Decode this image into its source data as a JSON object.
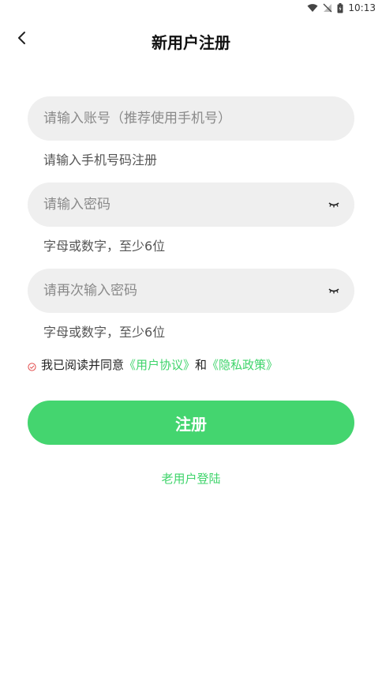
{
  "status_bar": {
    "time": "10:13"
  },
  "header": {
    "title": "新用户注册"
  },
  "account": {
    "placeholder": "请输入账号（推荐使用手机号）",
    "hint": "请输入手机号码注册"
  },
  "password": {
    "placeholder": "请输入密码",
    "hint": "字母或数字，至少6位"
  },
  "confirm_password": {
    "placeholder": "请再次输入密码",
    "hint": "字母或数字，至少6位"
  },
  "agreement": {
    "prefix": "我已阅读并同意",
    "user_agreement": "《用户协议》",
    "conjunction": "和",
    "privacy_policy": "《隐私政策》"
  },
  "register_button": "注册",
  "old_user_login": "老用户登陆",
  "colors": {
    "accent": "#44d56f",
    "link": "#3fd46b",
    "field_bg": "#efefef",
    "check": "#e24a4a"
  }
}
